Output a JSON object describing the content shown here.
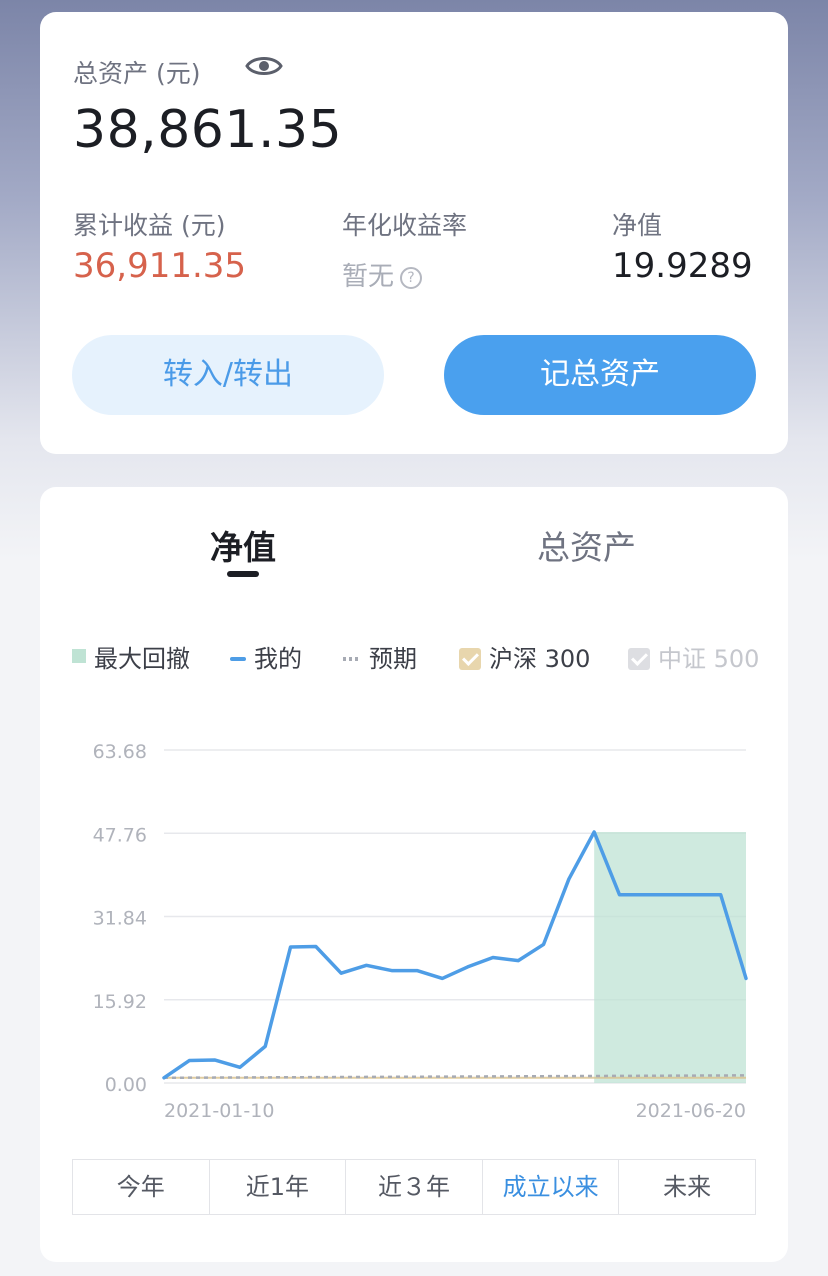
{
  "summary": {
    "total_label": "总资产 (元)",
    "total_value": "38,861.35",
    "cumulative_label": "累计收益 (元)",
    "cumulative_value": "36,911.35",
    "annual_label": "年化收益率",
    "annual_value": "暂无",
    "nav_label": "净值",
    "nav_value": "19.9289",
    "transfer_button": "转入/转出",
    "record_button": "记总资产",
    "help_icon_glyph": "?"
  },
  "tabs": {
    "active": "净值",
    "inactive": "总资产"
  },
  "legend": {
    "drawdown": "最大回撤",
    "mine": "我的",
    "expected": "预期",
    "hs300": "沪深 300",
    "zz500": "中证 500"
  },
  "colors": {
    "mine": "#4e9de6",
    "drawdown": "#bfe3d4",
    "expected": "#a7abb4",
    "hs300": "#d9c08a",
    "accent_blue": "#4aa0ee",
    "profit_red": "#d6624c"
  },
  "periods": {
    "this_year": "今年",
    "one_year": "近1年",
    "three_year": "近３年",
    "since_inception": "成立以来",
    "future": "未来",
    "selected": "成立以来"
  },
  "chart_data": {
    "type": "line",
    "x_start_label": "2021-01-10",
    "x_end_label": "2021-06-20",
    "yticks": [
      "0.00",
      "15.92",
      "31.84",
      "47.76",
      "63.68"
    ],
    "ylim": [
      0,
      63.68
    ],
    "series": [
      {
        "name": "我的",
        "values": [
          1.0,
          4.3,
          4.4,
          3.0,
          7.0,
          26.0,
          26.1,
          21.0,
          22.5,
          21.5,
          21.5,
          20.0,
          22.2,
          24.0,
          23.4,
          26.5,
          39.0,
          48.0,
          36.0,
          36.0,
          36.0,
          36.0,
          36.0,
          20.0
        ]
      },
      {
        "name": "预期",
        "values": [
          1.0,
          1.02,
          1.04,
          1.06,
          1.08,
          1.1,
          1.12,
          1.14,
          1.16,
          1.18,
          1.2,
          1.22,
          1.24,
          1.26,
          1.28,
          1.3,
          1.32,
          1.34,
          1.36,
          1.38,
          1.4,
          1.42,
          1.44,
          1.46
        ]
      },
      {
        "name": "沪深 300",
        "values": [
          1.0,
          1.0,
          1.0,
          1.0,
          1.0,
          1.0,
          1.0,
          1.0,
          1.0,
          1.0,
          1.0,
          1.0,
          1.0,
          1.0,
          1.0,
          1.0,
          1.0,
          1.0,
          1.0,
          1.0,
          1.0,
          1.0,
          1.0,
          1.0
        ]
      }
    ],
    "max_drawdown_range_index": [
      17,
      23
    ],
    "grid": true
  }
}
